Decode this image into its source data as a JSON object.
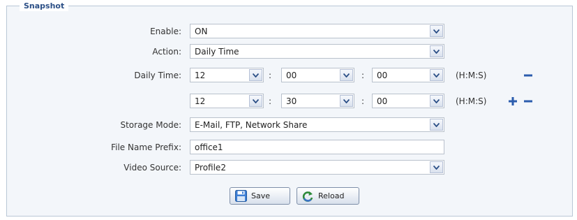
{
  "section": {
    "title": "Snapshot"
  },
  "fields": {
    "enable": {
      "label": "Enable:",
      "value": "ON"
    },
    "action": {
      "label": "Action:",
      "value": "Daily Time"
    },
    "daily_time": {
      "label": "Daily Time:",
      "unit": "(H:M:S)",
      "separator": ":",
      "rows": [
        {
          "h": "12",
          "m": "00",
          "s": "00"
        },
        {
          "h": "12",
          "m": "30",
          "s": "00"
        }
      ]
    },
    "storage_mode": {
      "label": "Storage Mode:",
      "value": "E-Mail, FTP, Network Share"
    },
    "file_name_prefix": {
      "label": "File Name Prefix:",
      "value": "office1"
    },
    "video_source": {
      "label": "Video Source:",
      "value": "Profile2"
    }
  },
  "buttons": {
    "save": "Save",
    "reload": "Reload"
  },
  "icons": {
    "plus": "plus-icon",
    "minus": "minus-icon",
    "save": "floppy-disk-icon",
    "reload": "refresh-icon"
  },
  "colors": {
    "accent": "#2b4f86",
    "plus_minus": "#2b5cad",
    "border": "#b9c7d6",
    "panel": "#f3f6fa"
  }
}
